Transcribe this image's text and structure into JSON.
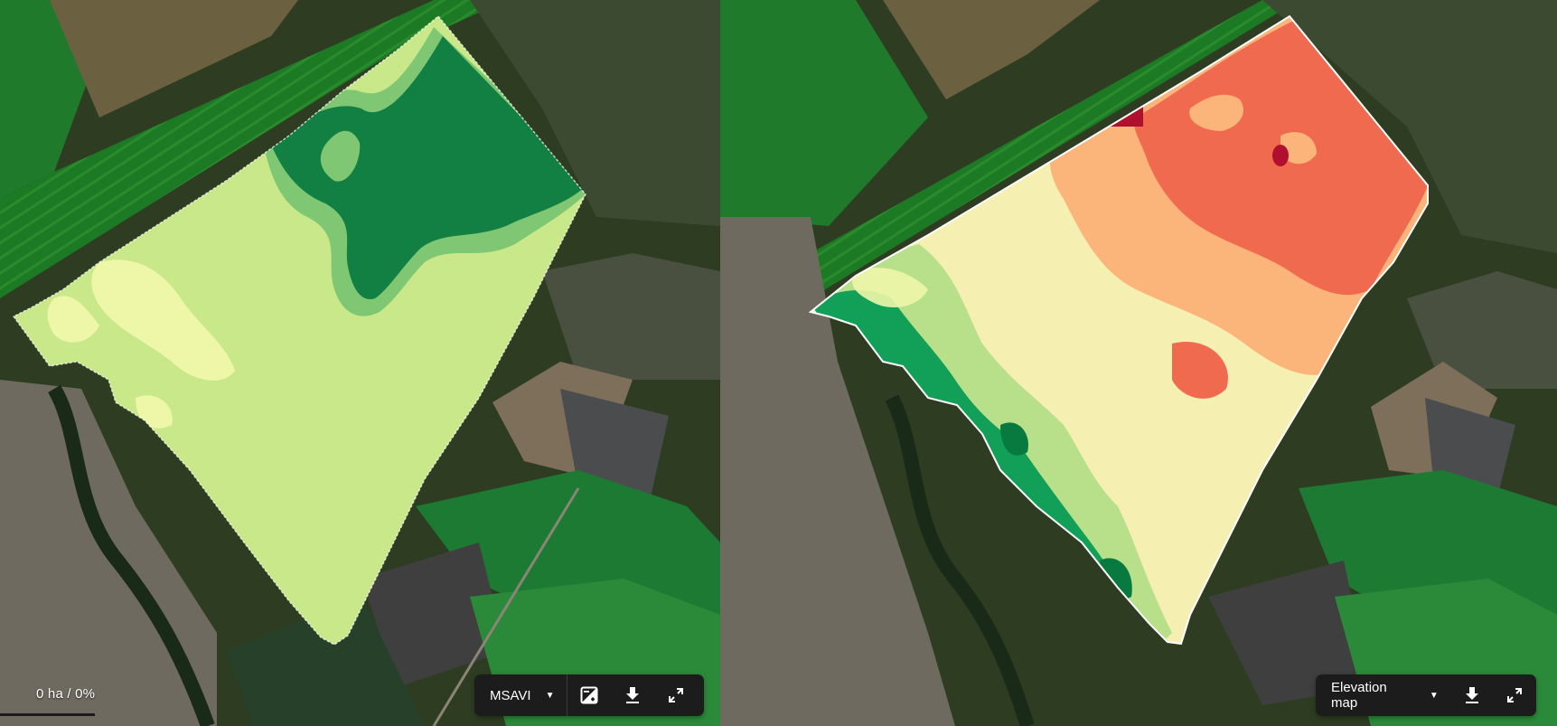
{
  "left_panel": {
    "area_stat": "0 ha / 0%",
    "layer_select": {
      "selected": "MSAVI"
    },
    "icons": [
      "contrast-icon",
      "download-icon",
      "fullscreen-icon"
    ]
  },
  "right_panel": {
    "layer_select": {
      "selected": "Elevation map"
    },
    "icons": [
      "download-icon",
      "fullscreen-icon"
    ]
  },
  "colors": {
    "msavi_low": "#c9e88a",
    "msavi_very_low": "#eef6a8",
    "msavi_mid": "#7fc772",
    "msavi_high": "#138043",
    "elev_low": "#12a058",
    "elev_mid_low": "#b8e08b",
    "elev_mid": "#f6efb2",
    "elev_mid_high": "#fbb47a",
    "elev_high": "#f06a4f",
    "elev_peak": "#b0102e",
    "toolbar_bg": "#1c1c1c"
  }
}
